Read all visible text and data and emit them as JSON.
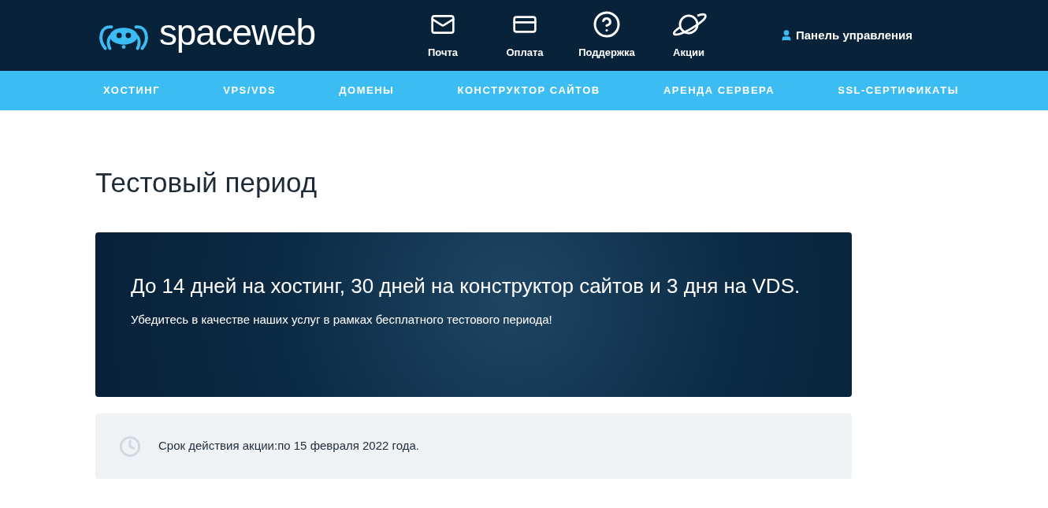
{
  "logo": {
    "text": "spaceweb"
  },
  "top_links": [
    {
      "label": "Почта",
      "kind": "mail"
    },
    {
      "label": "Оплата",
      "kind": "card"
    },
    {
      "label": "Поддержка",
      "kind": "help"
    },
    {
      "label": "Акции",
      "kind": "planet"
    }
  ],
  "account_link": {
    "label": "Панель управления"
  },
  "nav": [
    "ХОСТИНГ",
    "VPS/VDS",
    "ДОМЕНЫ",
    "КОНСТРУКТОР САЙТОВ",
    "АРЕНДА СЕРВЕРА",
    "SSL-СЕРТИФИКАТЫ"
  ],
  "page_title": "Тестовый период",
  "banner": {
    "heading": "До 14 дней на хостинг, 30 дней на конструктор сайтов и 3 дня на VDS.",
    "text": "Убедитесь в качестве наших услуг в рамках бесплатного тестового периода!"
  },
  "validity": {
    "text": "Срок действия акции:по 15 февраля 2022 года."
  }
}
